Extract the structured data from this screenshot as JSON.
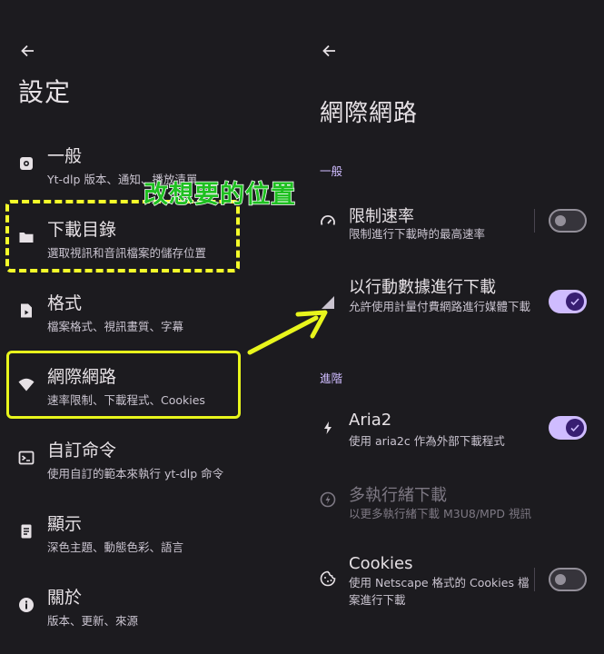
{
  "left": {
    "title": "設定",
    "items": [
      {
        "title": "一般",
        "subtitle": "Yt-dlp 版本、通知、播放清單",
        "icon": "gear-icon"
      },
      {
        "title": "下載目錄",
        "subtitle": "選取視訊和音訊檔案的儲存位置",
        "icon": "folder-icon"
      },
      {
        "title": "格式",
        "subtitle": "檔案格式、視訊畫質、字幕",
        "icon": "file-play-icon"
      },
      {
        "title": "網際網路",
        "subtitle": "速率限制、下載程式、Cookies",
        "icon": "wifi-icon"
      },
      {
        "title": "自訂命令",
        "subtitle": "使用自訂的範本來執行 yt-dlp 命令",
        "icon": "terminal-icon"
      },
      {
        "title": "顯示",
        "subtitle": "深色主題、動態色彩、語言",
        "icon": "document-icon"
      },
      {
        "title": "關於",
        "subtitle": "版本、更新、來源",
        "icon": "info-icon"
      }
    ]
  },
  "right": {
    "title": "網際網路",
    "section_general": "一般",
    "section_advanced": "進階",
    "items": [
      {
        "title": "限制速率",
        "subtitle": "限制進行下載時的最高速率",
        "icon": "speedometer-icon",
        "toggle": false
      },
      {
        "title": "以行動數據進行下載",
        "subtitle": "允許使用計量付費網路進行媒體下載",
        "icon": "cellular-icon",
        "toggle": true
      },
      {
        "title": "Aria2",
        "subtitle": "使用 aria2c 作為外部下載程式",
        "icon": "bolt-icon",
        "toggle": true
      },
      {
        "title": "多執行緒下載",
        "subtitle": "以更多執行緒下載 M3U8/MPD 視訊",
        "icon": "bolt-circle-icon",
        "disabled": true
      },
      {
        "title": "Cookies",
        "subtitle": "使用 Netscape 格式的 Cookies 檔案進行下載",
        "icon": "cookie-icon",
        "toggle": false
      }
    ]
  },
  "annotation": {
    "text": "改想要的位置"
  },
  "colors": {
    "background": "#1c1b1f",
    "accent": "#cfbcff",
    "highlight": "#f5ff2a",
    "annotation": "#1fc021"
  }
}
